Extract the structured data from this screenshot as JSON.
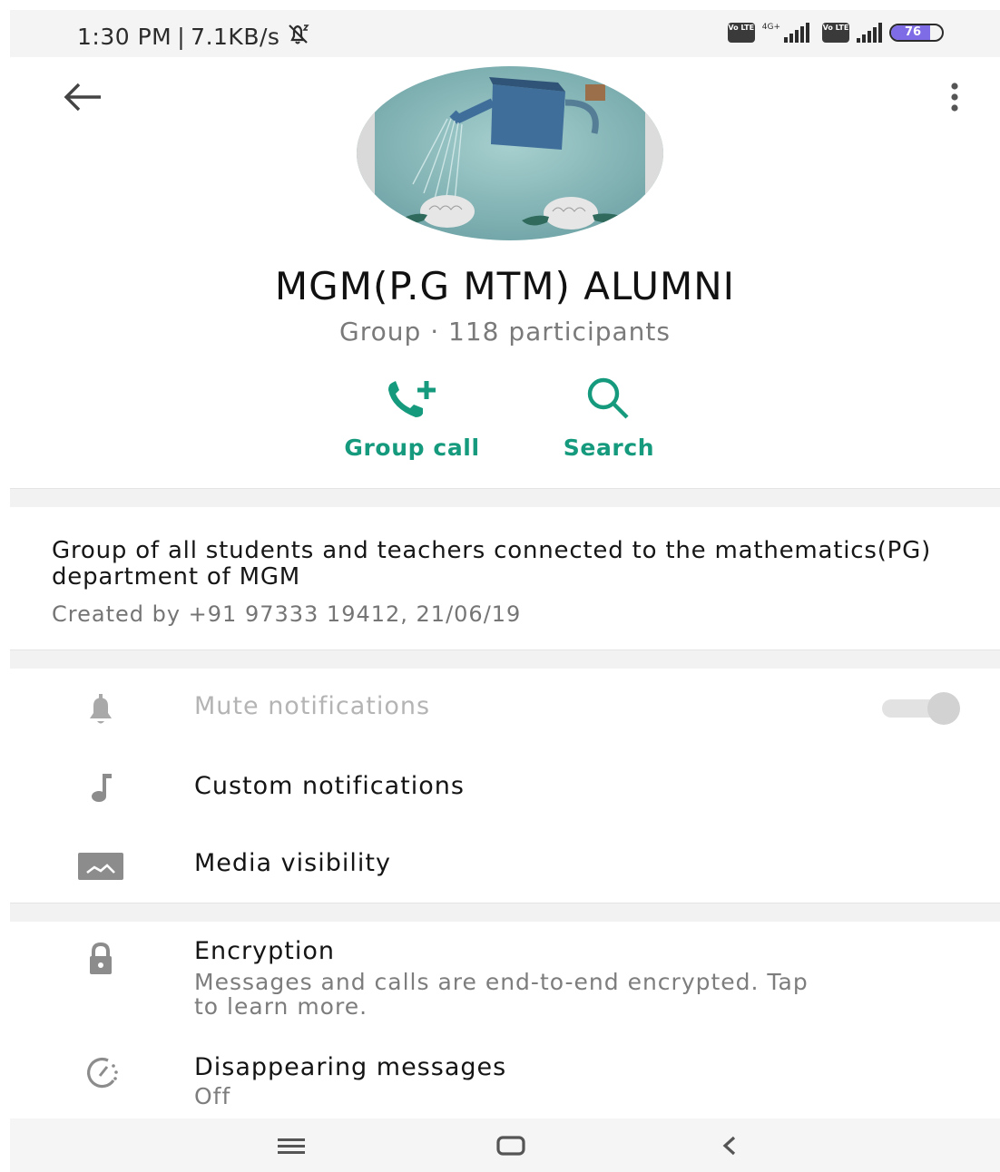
{
  "status_bar": {
    "time": "1:30 PM",
    "separator": "|",
    "speed": "7.1KB/s",
    "network_type": "4G+",
    "volte_label": "Vo LTE",
    "battery_level": "76",
    "accent_color": "#7e6ce6"
  },
  "header": {
    "back_icon": "arrow-left-icon",
    "menu_icon": "more-vert-icon"
  },
  "group": {
    "name": "MGM(P.G MTM) ALUMNI",
    "type": "Group",
    "dot": "·",
    "participants": "118 participants"
  },
  "actions": [
    {
      "label": "Group call",
      "icon": "add-call-icon"
    },
    {
      "label": "Search",
      "icon": "search-icon"
    }
  ],
  "description": {
    "text": "Group of all students and teachers connected to the mathematics(PG) department of MGM",
    "created": "Created by +91 97333 19412, 21/06/19"
  },
  "settings": {
    "mute": {
      "label": "Mute notifications",
      "icon": "bell-icon",
      "enabled": false
    },
    "custom": {
      "label": "Custom notifications",
      "icon": "music-note-icon"
    },
    "media": {
      "label": "Media visibility",
      "icon": "image-icon"
    }
  },
  "security": {
    "encryption": {
      "label": "Encryption",
      "sub": "Messages and calls are end-to-end encrypted. Tap to learn more.",
      "icon": "lock-icon"
    },
    "disappearing": {
      "label": "Disappearing messages",
      "sub": "Off",
      "icon": "timer-icon"
    }
  },
  "colors": {
    "accent": "#159a7e",
    "icon_gray": "#8c8c8c"
  }
}
